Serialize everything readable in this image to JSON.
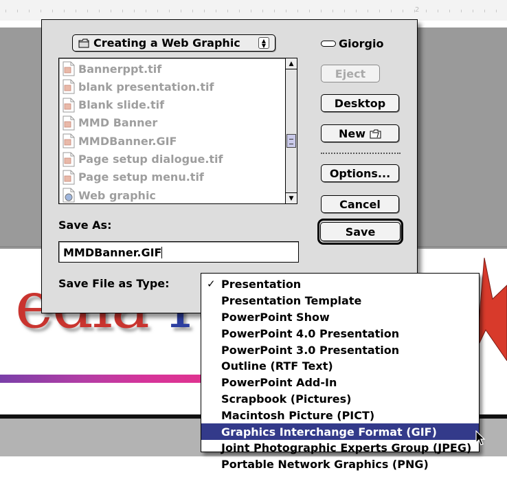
{
  "dialog": {
    "folder_popup": {
      "label": "Creating a Web Graphic",
      "icon": "folder-icon"
    },
    "volume": {
      "label": "Giorgio",
      "icon": "disk-icon"
    },
    "files": [
      {
        "name": "Bannerppt.tif",
        "icon": "document-icon"
      },
      {
        "name": "blank presentation.tif",
        "icon": "document-icon"
      },
      {
        "name": "Blank slide.tif",
        "icon": "document-icon"
      },
      {
        "name": "MMD Banner",
        "icon": "document-icon"
      },
      {
        "name": "MMDBanner.GIF",
        "icon": "document-icon"
      },
      {
        "name": "Page setup dialogue.tif",
        "icon": "document-icon"
      },
      {
        "name": "Page setup menu.tif",
        "icon": "document-icon"
      },
      {
        "name": "Web graphic",
        "icon": "web-document-icon"
      }
    ],
    "buttons": {
      "eject": "Eject",
      "desktop": "Desktop",
      "new": "New",
      "options": "Options...",
      "cancel": "Cancel",
      "save": "Save"
    },
    "save_as_label": "Save As:",
    "file_name": "MMDBanner.GIF",
    "type_label": "Save File as Type:"
  },
  "type_menu": {
    "checked_index": 0,
    "selected_index": 9,
    "items": [
      "Presentation",
      "Presentation Template",
      "PowerPoint Show",
      "PowerPoint 4.0 Presentation",
      "PowerPoint 3.0 Presentation",
      "Outline (RTF Text)",
      "PowerPoint Add-In",
      "Scrapbook (Pictures)",
      "Macintosh Picture (PICT)",
      "Graphics Interchange Format (GIF)",
      "Joint Photographic Experts Group (JPEG)",
      "Portable Network Graphics (PNG)"
    ]
  },
  "background": {
    "slide_text_red": "edia",
    "slide_text_blue": "I",
    "ruler_number": "2"
  },
  "colors": {
    "menu_highlight": "#333a8a",
    "slide_red": "#c9342f",
    "slide_blue": "#2d3fa0",
    "dialog_bg": "#dddddd"
  }
}
